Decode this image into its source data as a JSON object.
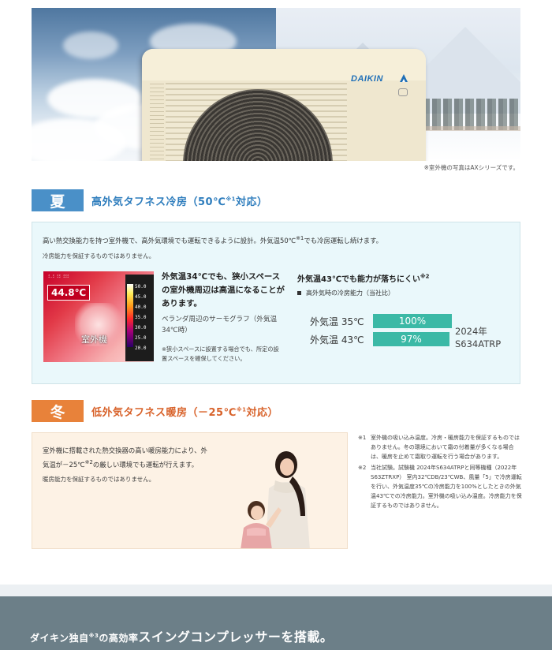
{
  "hero": {
    "brand_logo": "DAIKIN",
    "photo_note": "※室外機の写真はAXシリーズです。"
  },
  "summer": {
    "tag": "夏",
    "title_main": "高外気タフネス冷房（50℃",
    "title_sup": "※1",
    "title_end": "対応）",
    "color": "#4a90c8",
    "line1_a": "高い熱交換能力を持つ室外機で、高外気環境でも運転できるように設計。外気温50℃",
    "line1_sup": "※1",
    "line1_b": "でも冷房運転し続けます。",
    "line2": "冷房能力を保証するものではありません。",
    "thermograph": {
      "temperature": "44.8℃",
      "label": "室外機",
      "top_text": "ﾐ.ﾐ ﾐﾐ    ﾐﾐﾐ",
      "scale": [
        "50.0",
        "45.0",
        "40.0",
        "35.0",
        "30.0",
        "25.0",
        "20.0"
      ]
    },
    "mid_heading": "外気温34℃でも、狭小スペースの室外機周辺は高温になることがあります。",
    "mid_caption": "ベランダ周辺のサーモグラフ（外気温34℃時）",
    "mid_note": "※狭小スペースに設置する場合でも、所定の設置スペースを確保してください。",
    "right_heading": "外気温43℃でも能力が落ちにくい",
    "right_heading_sup": "※2",
    "right_bullet": "高外気時の冷房能力（当社比）",
    "rows": [
      {
        "label": "外気温 35℃",
        "value": "100%",
        "percent": 100
      },
      {
        "label": "外気温 43℃",
        "value": "97%",
        "percent": 97
      }
    ],
    "model_year": "2024年",
    "model_name": "S634ATRP"
  },
  "winter": {
    "tag": "冬",
    "title_main": "低外気タフネス暖房（－25℃",
    "title_sup": "※1",
    "title_end": "対応）",
    "color": "#e8823a",
    "line1": "室外機に搭載された熱交換器の高い暖房能力により、外",
    "line2_a": "気温が－25℃",
    "line2_sup": "※2",
    "line2_b": "の厳しい環境でも運転が行えます。",
    "line3": "暖房能力を保証するものではありません。"
  },
  "footnotes": [
    {
      "key": "※1",
      "text": "室外機の吸い込み温度。冷房・暖房能力を保証するものではありません。冬の環境において霜の付着量が多くなる場合は、暖房を止めて霜取り運転を行う場合があります。"
    },
    {
      "key": "※2",
      "text": "当社試験。試験機 2024年S634ATRPと同等機種（2022年S63ZTRXP） 室内32℃DB/23℃WB、風量「5」で冷房運転を行い、外気温度35℃の冷房能力を100%としたときの外気温43℃での冷房能力。室外機の吸い込み温度。冷房能力を保証するものではありません。"
    }
  ],
  "bottom": {
    "prefix": "ダイキン独自",
    "sup": "※3",
    "mid": "の高効率",
    "big": "スイングコンプレッサーを搭載。"
  }
}
